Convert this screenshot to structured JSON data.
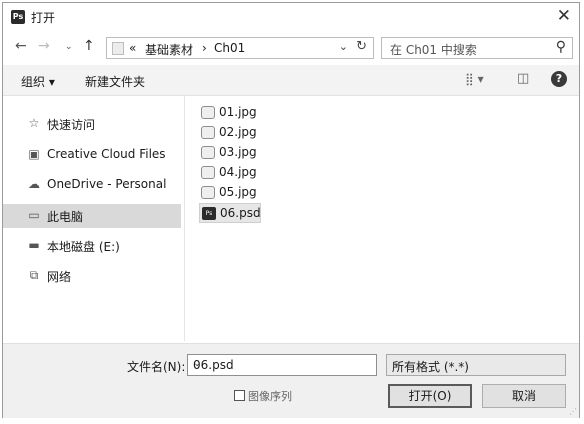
{
  "window": {
    "title": "打开",
    "logo": "Ps"
  },
  "nav": {
    "back_icon": "back-arrow-icon",
    "path": [
      "«",
      "基础素材",
      "Ch01"
    ],
    "search_placeholder": "在 Ch01 中搜索"
  },
  "toolbar": {
    "organize_label": "组织 ▾",
    "new_folder_label": "新建文件夹"
  },
  "sidebar": {
    "items": [
      {
        "label": "快速访问",
        "icon": "star-icon",
        "selected": false
      },
      {
        "label": "Creative Cloud Files",
        "icon": "cloud-files-icon",
        "selected": false
      },
      {
        "label": "OneDrive - Personal",
        "icon": "onedrive-icon",
        "selected": false
      },
      {
        "label": "此电脑",
        "icon": "monitor-icon",
        "selected": true
      },
      {
        "label": "本地磁盘 (E:)",
        "icon": "drive-icon",
        "selected": false
      },
      {
        "label": "网络",
        "icon": "network-icon",
        "selected": false
      }
    ]
  },
  "files": [
    {
      "name": "01.jpg",
      "type": "jpg",
      "selected": false
    },
    {
      "name": "02.jpg",
      "type": "jpg",
      "selected": false
    },
    {
      "name": "03.jpg",
      "type": "jpg",
      "selected": false
    },
    {
      "name": "04.jpg",
      "type": "jpg",
      "selected": false
    },
    {
      "name": "05.jpg",
      "type": "jpg",
      "selected": false
    },
    {
      "name": "06.psd",
      "type": "psd",
      "selected": true
    }
  ],
  "footer": {
    "filename_label": "文件名(N):",
    "filename_value": "06.psd",
    "filetype_value": "所有格式 (*.*)",
    "sequence_label": "图像序列",
    "open_label": "打开(O)",
    "cancel_label": "取消"
  }
}
